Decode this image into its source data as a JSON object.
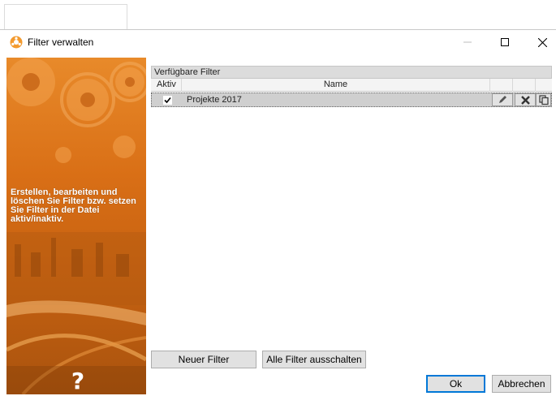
{
  "window": {
    "title": "Filter verwalten",
    "controls": [
      "minimize",
      "maximize",
      "close"
    ]
  },
  "sidebar": {
    "description": "Erstellen, bearbeiten und löschen Sie Filter bzw. setzen Sie Filter in der Datei aktiv/inaktiv.",
    "help_label": "?"
  },
  "grid": {
    "caption": "Verfügbare Filter",
    "columns": {
      "active": "Aktiv",
      "name": "Name"
    },
    "rows": [
      {
        "active": true,
        "name": "Projekte 2017"
      }
    ]
  },
  "buttons": {
    "new_filter": "Neuer Filter",
    "disable_all": "Alle Filter ausschalten",
    "ok": "Ok",
    "cancel": "Abbrechen"
  },
  "colors": {
    "accent": "#0078d7",
    "sidebar_orange": "#d96f16",
    "row_selected": "#cfcfcf"
  }
}
